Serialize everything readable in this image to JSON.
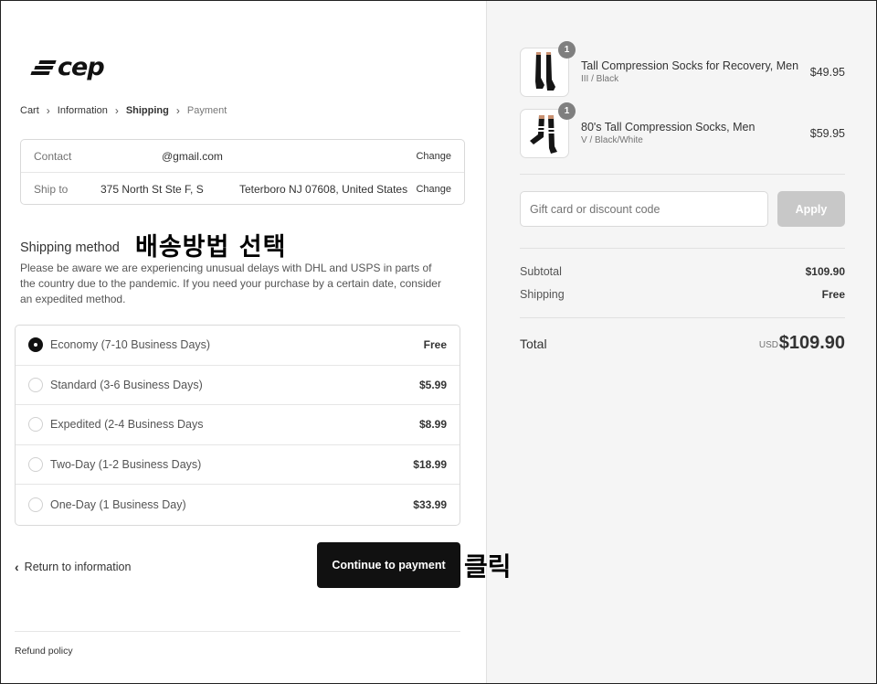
{
  "logo": {
    "text": "cep"
  },
  "breadcrumb": {
    "items": [
      {
        "label": "Cart",
        "state": "link"
      },
      {
        "label": "Information",
        "state": "link"
      },
      {
        "label": "Shipping",
        "state": "current"
      },
      {
        "label": "Payment",
        "state": "muted"
      }
    ],
    "separator_icon": "chevron-right-icon"
  },
  "review": {
    "contact_label": "Contact",
    "contact_value": "@gmail.com",
    "ship_to_label": "Ship to",
    "ship_to_street": "375 North St Ste F, S",
    "ship_to_city": "Teterboro NJ 07608, United States",
    "change_label": "Change"
  },
  "shipping": {
    "title": "Shipping method",
    "annotation": "배송방법 선택",
    "notice": "Please be aware we are experiencing unusual delays with DHL and USPS in parts of the country due to the pandemic. If you need your purchase by a certain date, consider an expedited method.",
    "rates": [
      {
        "name": "Economy (7-10 Business Days)",
        "price": "Free",
        "selected": true
      },
      {
        "name": "Standard (3-6 Business Days)",
        "price": "$5.99",
        "selected": false
      },
      {
        "name": "Expedited (2-4 Business Days",
        "price": "$8.99",
        "selected": false
      },
      {
        "name": "Two-Day (1-2 Business Days)",
        "price": "$18.99",
        "selected": false
      },
      {
        "name": "One-Day (1 Business Day)",
        "price": "$33.99",
        "selected": false
      }
    ]
  },
  "actions": {
    "return_label": "Return to information",
    "return_icon": "chevron-left-icon",
    "continue_label": "Continue to payment",
    "click_annotation": "클릭"
  },
  "footer": {
    "refund_policy": "Refund policy"
  },
  "order": {
    "items": [
      {
        "quantity": "1",
        "title": "Tall Compression Socks for Recovery, Men",
        "variant": "III / Black",
        "price": "$49.95",
        "image": "black-socks-image"
      },
      {
        "quantity": "1",
        "title": "80's Tall Compression Socks, Men",
        "variant": "V / Black/White",
        "price": "$59.95",
        "image": "black-white-socks-image"
      }
    ],
    "discount_placeholder": "Gift card or discount code",
    "apply_label": "Apply",
    "subtotal_label": "Subtotal",
    "subtotal_value": "$109.90",
    "shipping_label": "Shipping",
    "shipping_value": "Free",
    "total_label": "Total",
    "currency": "USD",
    "total_value": "$109.90"
  },
  "colors": {
    "primary_button": "#111111",
    "apply_disabled": "#c8c8c8",
    "summary_background": "#f5f5f5",
    "quantity_badge": "#7f7f7f"
  }
}
